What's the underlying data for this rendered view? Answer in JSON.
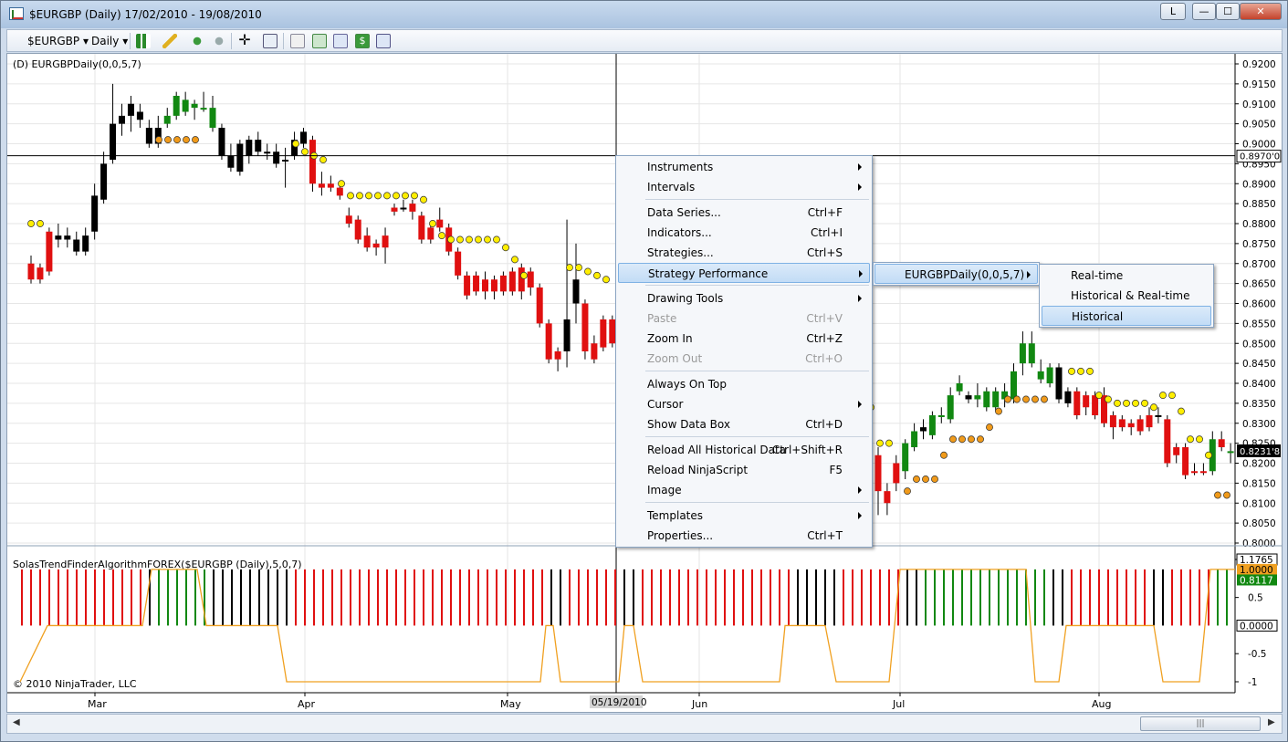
{
  "window": {
    "title": "$EURGBP (Daily)  17/02/2010 - 19/08/2010",
    "buttons": {
      "l": "L",
      "minimize": "—",
      "maximize": "☐",
      "close": "✕"
    }
  },
  "toolbar": {
    "instrument": "$EURGBP",
    "interval": "Daily",
    "icons": [
      "candlestick-icon",
      "pencil-icon",
      "pan-icon",
      "zoom-icon",
      "crosshair-icon",
      "magnifier-icon",
      "properties-icon",
      "strategy-icon",
      "chart-icon",
      "dollar-icon",
      "datagrid-icon"
    ]
  },
  "chart": {
    "main_panel_label": "(D) EURGBPDaily(0,0,5,7)",
    "indicator_panel_label": "SolasTrendFinderAlgorithmFOREX($EURGBP (Daily),5,0,7)",
    "copyright": "© 2010 NinjaTrader, LLC",
    "price_axis": [
      "0.9200",
      "0.9150",
      "0.9100",
      "0.9050",
      "0.9000",
      "0.8950",
      "0.8900",
      "0.8850",
      "0.8800",
      "0.8750",
      "0.8700",
      "0.8650",
      "0.8600",
      "0.8550",
      "0.8500",
      "0.8450",
      "0.8400",
      "0.8350",
      "0.8300",
      "0.8250",
      "0.8200",
      "0.8150",
      "0.8100",
      "0.8050",
      "0.8000"
    ],
    "crosshair_price": "0.8970'0",
    "last_price": "0.8231'8",
    "indicator_axis": [
      "1.1765",
      "0.5",
      "-0.5",
      "-1"
    ],
    "indicator_value_top": "1.0000",
    "indicator_value_green": "0.8117",
    "indicator_value_zero": "0.0000",
    "x_axis": [
      "Mar",
      "Apr",
      "May",
      "Jun",
      "Jul",
      "Aug"
    ],
    "crosshair_date": "05/19/2010",
    "colors": {
      "up": "#118811",
      "down": "#e01010",
      "neutral": "#000000",
      "dot_yellow": "#ffee00",
      "dot_orange": "#f09a1a",
      "line": "#f0a020"
    }
  },
  "context_menu": {
    "items": [
      {
        "label": "Instruments",
        "shortcut": "",
        "submenu": true,
        "disabled": false
      },
      {
        "label": "Intervals",
        "shortcut": "",
        "submenu": true,
        "disabled": false
      },
      {
        "sep": true
      },
      {
        "label": "Data Series...",
        "shortcut": "Ctrl+F",
        "submenu": false,
        "disabled": false
      },
      {
        "label": "Indicators...",
        "shortcut": "Ctrl+I",
        "submenu": false,
        "disabled": false
      },
      {
        "label": "Strategies...",
        "shortcut": "Ctrl+S",
        "submenu": false,
        "disabled": false
      },
      {
        "label": "Strategy Performance",
        "shortcut": "",
        "submenu": true,
        "disabled": false,
        "highlighted": true
      },
      {
        "sep": true
      },
      {
        "label": "Drawing Tools",
        "shortcut": "",
        "submenu": true,
        "disabled": false
      },
      {
        "label": "Paste",
        "shortcut": "Ctrl+V",
        "submenu": false,
        "disabled": true
      },
      {
        "label": "Zoom In",
        "shortcut": "Ctrl+Z",
        "submenu": false,
        "disabled": false
      },
      {
        "label": "Zoom Out",
        "shortcut": "Ctrl+O",
        "submenu": false,
        "disabled": true
      },
      {
        "sep": true
      },
      {
        "label": "Always On Top",
        "shortcut": "",
        "submenu": false,
        "disabled": false
      },
      {
        "label": "Cursor",
        "shortcut": "",
        "submenu": true,
        "disabled": false
      },
      {
        "label": "Show Data Box",
        "shortcut": "Ctrl+D",
        "submenu": false,
        "disabled": false
      },
      {
        "sep": true
      },
      {
        "label": "Reload All Historical Data",
        "shortcut": "Ctrl+Shift+R",
        "submenu": false,
        "disabled": false
      },
      {
        "label": "Reload NinjaScript",
        "shortcut": "F5",
        "submenu": false,
        "disabled": false
      },
      {
        "label": "Image",
        "shortcut": "",
        "submenu": true,
        "disabled": false
      },
      {
        "sep": true
      },
      {
        "label": "Templates",
        "shortcut": "",
        "submenu": true,
        "disabled": false
      },
      {
        "label": "Properties...",
        "shortcut": "Ctrl+T",
        "submenu": false,
        "disabled": false
      }
    ]
  },
  "submenu1": {
    "label": "EURGBPDaily(0,0,5,7)"
  },
  "submenu2": {
    "items": [
      "Real-time",
      "Historical & Real-time",
      "Historical"
    ],
    "highlighted": 2
  }
}
